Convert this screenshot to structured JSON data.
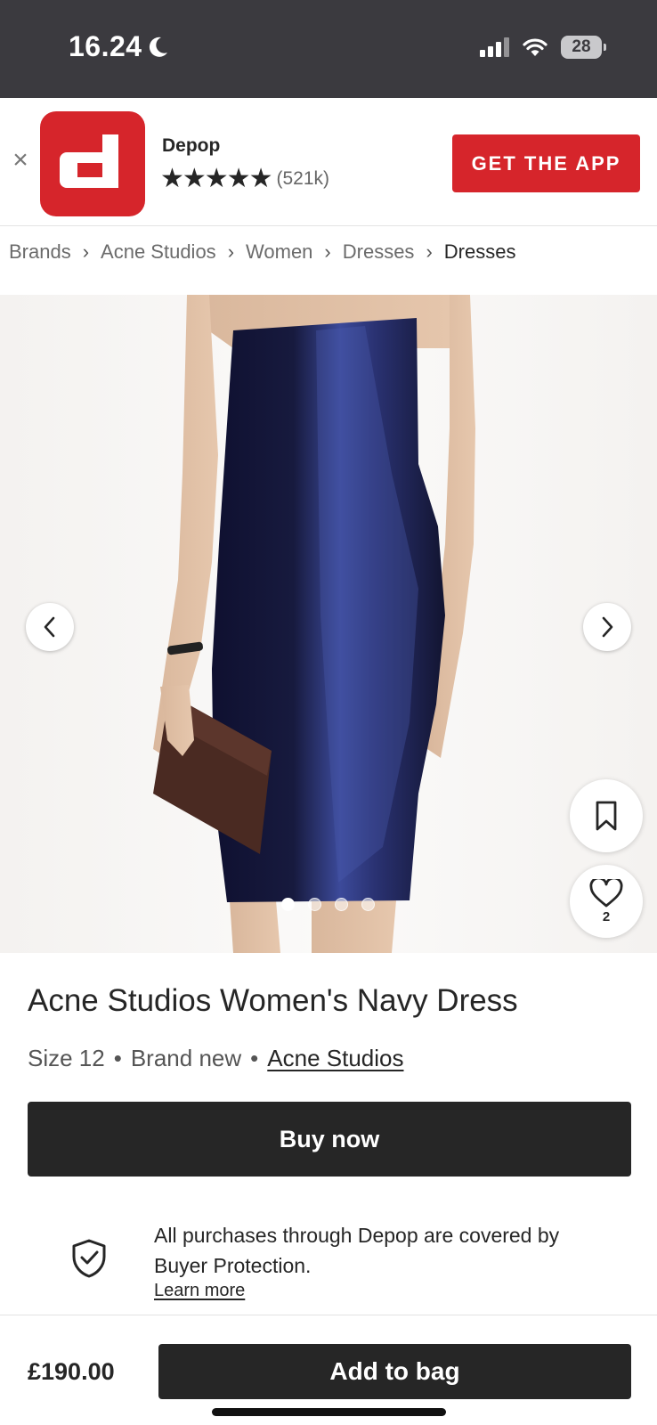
{
  "status_bar": {
    "time": "16.24",
    "battery": "28",
    "icons": [
      "moon-icon",
      "signal-icon",
      "wifi-icon",
      "battery-icon"
    ]
  },
  "app_banner": {
    "app_name": "Depop",
    "stars": "★★★★★",
    "rating_count": "(521k)",
    "cta_label": "GET THE APP",
    "icon_letter": "d",
    "brand_color": "#d6252b"
  },
  "breadcrumb": {
    "items": [
      "Brands",
      "Acne Studios",
      "Women",
      "Dresses",
      "Dresses"
    ],
    "current_index": 4
  },
  "gallery": {
    "image_count": 4,
    "active_index": 0,
    "like_count": "2",
    "icons": [
      "chevron-left-icon",
      "chevron-right-icon",
      "bookmark-icon",
      "heart-icon"
    ]
  },
  "product": {
    "title": "Acne Studios Women's Navy Dress",
    "size": "Size 12",
    "condition": "Brand new",
    "brand": "Acne Studios",
    "separator": "•",
    "buy_now_label": "Buy now"
  },
  "protection": {
    "text": "All purchases through Depop are covered by Buyer Protection.",
    "learn_more": "Learn more"
  },
  "bottom_bar": {
    "price": "£190.00",
    "add_to_bag_label": "Add to bag"
  },
  "colors": {
    "primary_dark": "#262626",
    "status_bar": "#3b3a3f",
    "dress_navy": "#1d2452"
  }
}
